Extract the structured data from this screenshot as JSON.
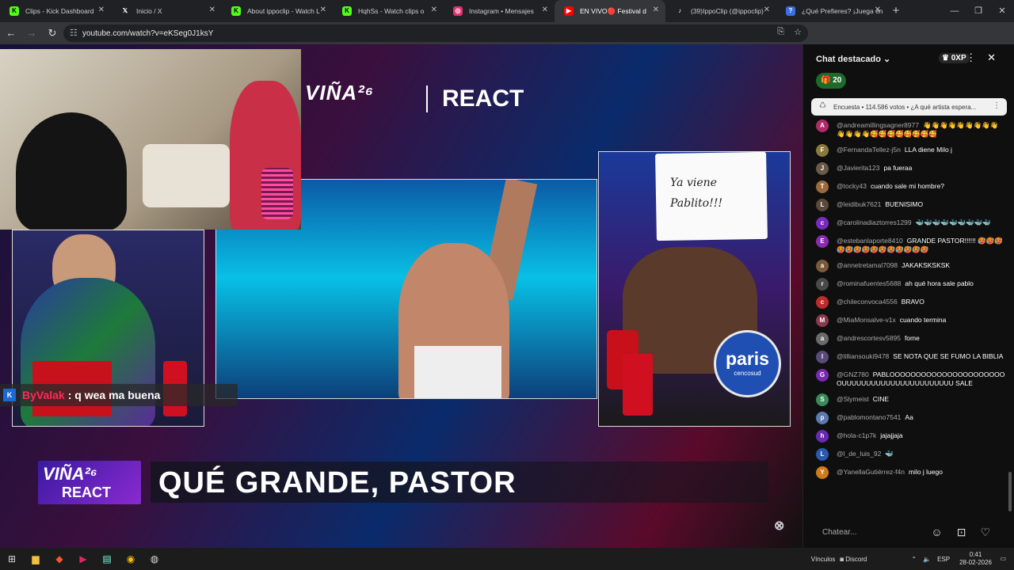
{
  "browser": {
    "tabs": [
      {
        "label": "Clips - Kick Dashboard",
        "icon": "kick-icon",
        "color": "#53fc18"
      },
      {
        "label": "Inicio / X",
        "icon": "x-icon",
        "color": "#000000"
      },
      {
        "label": "About ippoclip - Watch L",
        "icon": "kick-icon",
        "color": "#53fc18"
      },
      {
        "label": "HqhSs - Watch clips o",
        "icon": "kick-icon",
        "color": "#53fc18"
      },
      {
        "label": "Instagram • Mensajes",
        "icon": "instagram-icon",
        "color": "#e1306c"
      },
      {
        "label": "EN VIVO🔴 Festival d",
        "icon": "youtube-icon",
        "color": "#ff0000"
      },
      {
        "label": "(39)IppoClip (@ippoclip)",
        "icon": "tiktok-icon",
        "color": "#000000"
      },
      {
        "label": "¿Qué Prefieres? ¡Juega en",
        "icon": "game-icon",
        "color": "#3b6fe0"
      }
    ],
    "url": "youtube.com/watch?v=eKSeg0J1ksY"
  },
  "video": {
    "brand": "VIÑA²⁶",
    "brand_react": "REACT",
    "sign_text": "Ya viene Pablito!!!",
    "paris_logo": "paris",
    "paris_sub": "cencosud",
    "overlay_chat_user": "ByValak",
    "overlay_chat_msg": ": q wea ma buena",
    "lower_third": "QUÉ GRANDE, PASTOR",
    "badge_top": "VIÑA²⁶",
    "badge_bottom": "REACT"
  },
  "chat": {
    "title": "Chat destacado",
    "xp": "0XP",
    "gift_count": "20",
    "poll": "Encuesta • 114.586 votos • ¿A qué artista espera...",
    "messages": [
      {
        "user": "@andreamillingsagner8977",
        "text": "👋👋👋👋👋👋👋👋👋👋👋👋👋🥰🥰🥰🥰🥰🥰🥰🥰",
        "av": "A",
        "color": "#b02a6a"
      },
      {
        "user": "@FernandaTellez-j5n",
        "text": "LLA diene Milo j",
        "av": "F",
        "color": "#8a7a3a"
      },
      {
        "user": "@Javierita123",
        "text": "pa fueraa",
        "av": "J",
        "color": "#6a5a4a"
      },
      {
        "user": "@tocky43",
        "text": "cuando sale mi hombre?",
        "av": "T",
        "color": "#9a6a3a"
      },
      {
        "user": "@leidibuk7621",
        "text": "BUENISIMO",
        "av": "L",
        "color": "#5a4a3a"
      },
      {
        "user": "@carolinadiaztorres1299",
        "text": "🐳🐳🐳🐳🐳🐳🐳🐳🐳",
        "av": "c",
        "color": "#7a2ac0"
      },
      {
        "user": "@estebanlaporte8410",
        "text": "GRANDE PASTOR!!!!!! 🥵🥵🥵🥵🥵🥵🥵🥵🥵🥵🥵🥵🥵🥵",
        "av": "E",
        "color": "#8a2ab0"
      },
      {
        "user": "@annetretamal7098",
        "text": "JAKAKSKSKSK",
        "av": "a",
        "color": "#7a5a3a"
      },
      {
        "user": "@rominafuentes5688",
        "text": "ah qué hora sale pablo",
        "av": "r",
        "color": "#4a4a4a"
      },
      {
        "user": "@chileconvoca4556",
        "text": "BRAVO",
        "av": "c",
        "color": "#c02a2a"
      },
      {
        "user": "@MiaMonsalve-v1x",
        "text": "cuando termina",
        "av": "M",
        "color": "#8a3a4a"
      },
      {
        "user": "@andrescortesv5895",
        "text": "fome",
        "av": "a",
        "color": "#6a6a6a"
      },
      {
        "user": "@lilliansouki9478",
        "text": "SE NOTA QUE SE FUMO LA BIBLIA",
        "av": "l",
        "color": "#5a4a7a"
      },
      {
        "user": "@GNZ780",
        "text": "PABLOOOOOOOOOOOOOOOOOOOOOOOUUUUUUUUUUUUUUUUUUUUUUU SALE",
        "av": "G",
        "color": "#7a2ab0"
      },
      {
        "user": "@Slymeist",
        "text": "CINE",
        "av": "S",
        "color": "#3a8a5a"
      },
      {
        "user": "@pablomontano7541",
        "text": "Aa",
        "av": "p",
        "color": "#5a7ab0"
      },
      {
        "user": "@hola-c1p7k",
        "text": "jajajjaja",
        "av": "h",
        "color": "#6a2ab0"
      },
      {
        "user": "@l_de_luis_92",
        "text": "🐳",
        "av": "L",
        "color": "#2a5ab0"
      },
      {
        "user": "@YanellaGutiérrez-f4n",
        "text": "milo j luego",
        "av": "Y",
        "color": "#d07a1a"
      }
    ],
    "input_placeholder": "Chatear..."
  },
  "taskbar": {
    "vinculos": "Vínculos",
    "discord": "Discord",
    "lang": "ESP",
    "time": "0:41",
    "date": "28-02-2026"
  }
}
